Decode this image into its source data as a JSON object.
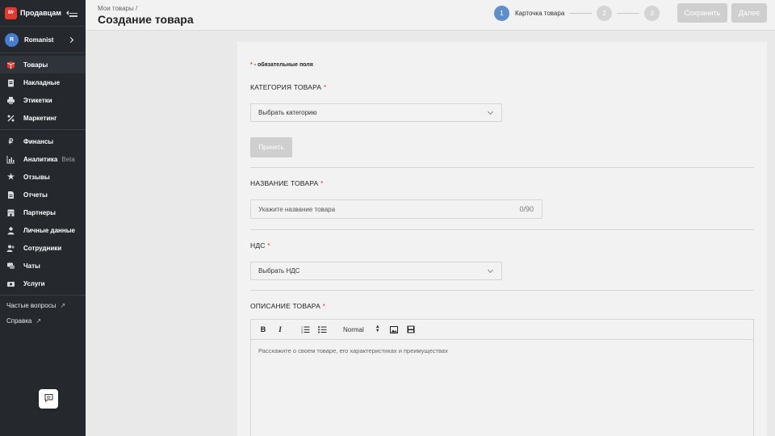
{
  "brand": {
    "logo_text": "Mr",
    "name": "Продавцам"
  },
  "user": {
    "initial": "R",
    "name": "Romanist"
  },
  "nav": {
    "group1": [
      {
        "label": "Товары",
        "icon": "box-icon"
      },
      {
        "label": "Накладные",
        "icon": "clipboard-icon"
      },
      {
        "label": "Этикетки",
        "icon": "printer-icon"
      },
      {
        "label": "Маркетинг",
        "icon": "percent-icon"
      }
    ],
    "group2": [
      {
        "label": "Финансы",
        "icon": "ruble-icon"
      },
      {
        "label": "Аналитика",
        "icon": "chart-icon",
        "badge": "Beta"
      },
      {
        "label": "Отзывы",
        "icon": "star-icon"
      },
      {
        "label": "Отчеты",
        "icon": "document-icon"
      },
      {
        "label": "Партнеры",
        "icon": "store-icon"
      },
      {
        "label": "Личные данные",
        "icon": "person-icon"
      },
      {
        "label": "Сотрудники",
        "icon": "people-icon"
      },
      {
        "label": "Чаты",
        "icon": "chat-icon"
      },
      {
        "label": "Услуги",
        "icon": "services-icon"
      }
    ],
    "links": [
      {
        "label": "Частые вопросы"
      },
      {
        "label": "Справка"
      }
    ]
  },
  "header": {
    "breadcrumb": "Мои товары /",
    "title": "Создание товара",
    "steps": [
      {
        "number": "1",
        "label": "Карточка товара"
      },
      {
        "number": "2"
      },
      {
        "number": "3"
      }
    ],
    "save_label": "Сохранить",
    "next_label": "Далее"
  },
  "form": {
    "required_star": "*",
    "required_note": "- обязательные поля",
    "category": {
      "label": "КАТЕГОРИЯ ТОВАРА",
      "placeholder": "Выбрать категорию",
      "apply_label": "Принять"
    },
    "name": {
      "label": "НАЗВАНИЕ ТОВАРА",
      "placeholder": "Укажите название товара",
      "counter": "0/90"
    },
    "vat": {
      "label": "НДС",
      "placeholder": "Выбрать НДС"
    },
    "description": {
      "label": "ОПИСАНИЕ ТОВАРА",
      "format_value": "Normal",
      "placeholder": "Расскажите о своем товаре, его характеристиках и преимуществах"
    }
  },
  "colors": {
    "accent": "#5f8ec9",
    "required": "#e53935",
    "sidebar_bg": "#25292e",
    "brand": "#e8372f"
  }
}
